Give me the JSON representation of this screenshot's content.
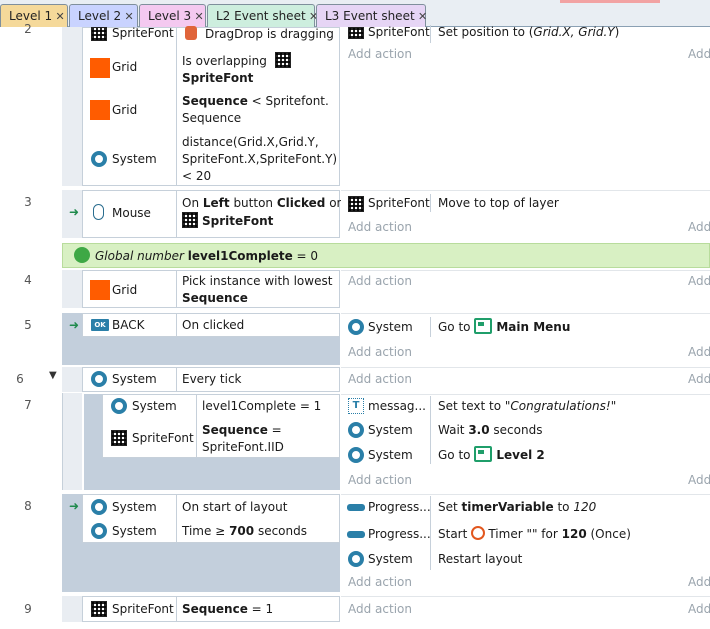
{
  "tabs": [
    {
      "label": "Level 1",
      "bg": "#f5d99a"
    },
    {
      "label": "Level 2",
      "bg": "#c9d3ff"
    },
    {
      "label": "Level 3",
      "bg": "#f4c9f0"
    },
    {
      "label": "L2 Event sheet",
      "bg": "#cdeede"
    },
    {
      "label": "L3 Event sheet",
      "bg": "#e6d5f5"
    }
  ],
  "close_glyph": "✕",
  "add_action": "Add action",
  "add_action_short": "Add",
  "events": {
    "e2": {
      "num": "2",
      "c1_obj": "SpriteFont",
      "c1_text": "DragDrop is dragging",
      "c2_obj": "Grid",
      "c2_text_a": "Is overlapping",
      "c2_text_b": "SpriteFont",
      "c3_obj": "Grid",
      "c3_bold": "Sequence",
      "c3_rest": " < Spritefont.",
      "c3_line2": "Sequence",
      "c4_obj": "System",
      "c4_line1": "distance(Grid.X,Grid.Y,",
      "c4_line2": "SpriteFont.X,SpriteFont.Y)",
      "c4_line3": "< 20",
      "a1_obj": "SpriteFont",
      "a1_pre": "Set position to (",
      "a1_it": "Grid.X, Grid.Y",
      "a1_post": ")"
    },
    "e3": {
      "num": "3",
      "c_obj": "Mouse",
      "c_pre": "On ",
      "c_b1": "Left",
      "c_mid": " button ",
      "c_b2": "Clicked",
      "c_post": " on",
      "c_b3": "SpriteFont",
      "a_obj": "SpriteFont",
      "a_text": "Move to top of layer"
    },
    "global": {
      "type": "Global number",
      "name": "level1Complete",
      "rest": " = 0"
    },
    "e4": {
      "num": "4",
      "c_obj": "Grid",
      "c_line1": "Pick instance with lowest",
      "c_bold": "Sequence"
    },
    "e5": {
      "num": "5",
      "c_obj": "BACK",
      "c_text": "On clicked",
      "a_obj": "System",
      "a_pre": "Go to",
      "a_bold": "Main Menu"
    },
    "e6": {
      "num": "6",
      "c_obj": "System",
      "c_text": "Every tick"
    },
    "e7": {
      "num": "7",
      "c1_obj": "System",
      "c1_text": "level1Complete = 1",
      "c2_obj": "SpriteFont",
      "c2_bold": "Sequence",
      "c2_rest": " =",
      "c2_line2": "SpriteFont.IID",
      "a1_obj": "messag...",
      "a1_pre": "Set text to ",
      "a1_it": "\"Congratulations!\"",
      "a2_obj": "System",
      "a2_pre": "Wait ",
      "a2_bold": "3.0",
      "a2_post": " seconds",
      "a3_obj": "System",
      "a3_pre": "Go to",
      "a3_bold": "Level 2"
    },
    "e8": {
      "num": "8",
      "c1_obj": "System",
      "c1_text": "On start of layout",
      "c2_obj": "System",
      "c2_pre": "Time ≥ ",
      "c2_bold": "700",
      "c2_post": " seconds",
      "a1_obj": "Progress...",
      "a1_pre": "Set ",
      "a1_bold": "timerVariable",
      "a1_mid": " to ",
      "a1_it": "120",
      "a2_obj": "Progress...",
      "a2_pre": "Start",
      "a2_mid": "Timer \"\" for ",
      "a2_bold": "120",
      "a2_post": " (Once)",
      "a3_obj": "System",
      "a3_text": "Restart layout"
    },
    "e9": {
      "num": "9",
      "c_obj": "SpriteFont",
      "c_bold": "Sequence",
      "c_rest": " = 1"
    }
  }
}
